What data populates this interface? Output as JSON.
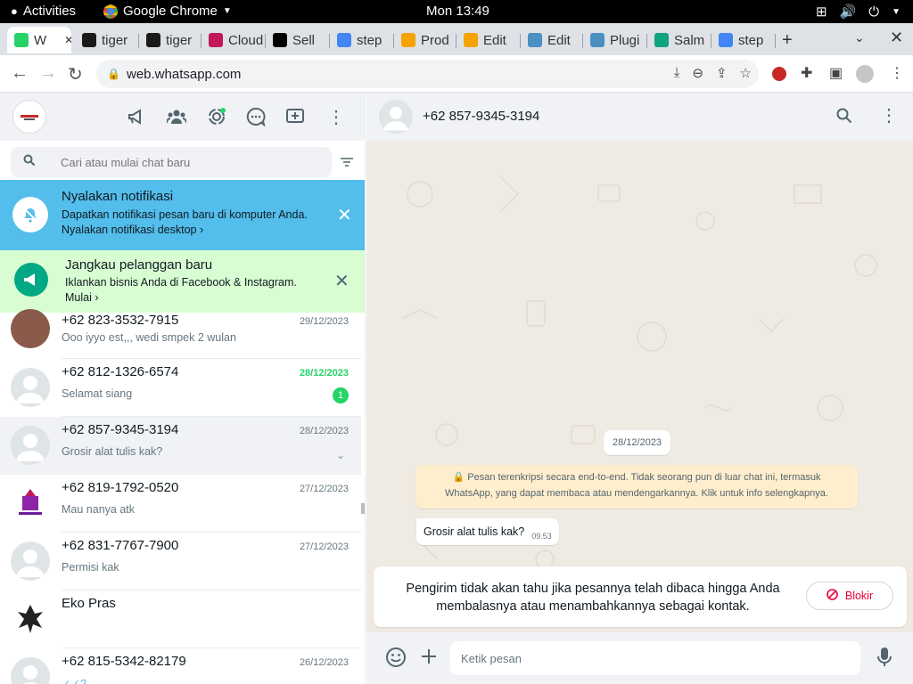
{
  "system": {
    "activities": "Activities",
    "app_name": "Google Chrome",
    "clock": "Mon 13:49"
  },
  "tabs": [
    {
      "label": "W",
      "favicon": "whatsapp-icon",
      "color": "#25d366"
    },
    {
      "label": "tiger",
      "favicon": "vnc-icon",
      "color": "#1a1a1a"
    },
    {
      "label": "tiger",
      "favicon": "vnc-icon",
      "color": "#1a1a1a"
    },
    {
      "label": "Cloud",
      "favicon": "cloudflare-icon",
      "color": "#c2185b"
    },
    {
      "label": "Sell",
      "favicon": "tiktok-icon",
      "color": "#000000"
    },
    {
      "label": "step",
      "favicon": "google-icon",
      "color": "#4285f4"
    },
    {
      "label": "Prod",
      "favicon": "site-icon",
      "color": "#f4a300"
    },
    {
      "label": "Edit",
      "favicon": "site-icon",
      "color": "#f4a300"
    },
    {
      "label": "Edit",
      "favicon": "puzzle-icon",
      "color": "#4a90c2"
    },
    {
      "label": "Plugi",
      "favicon": "puzzle-icon",
      "color": "#4a90c2"
    },
    {
      "label": "Salm",
      "favicon": "openai-icon",
      "color": "#10a37f"
    },
    {
      "label": "step",
      "favicon": "google-icon",
      "color": "#4285f4"
    }
  ],
  "browser": {
    "url": "web.whatsapp.com"
  },
  "sidebar": {
    "search_placeholder": "Cari atau mulai chat baru",
    "notif_banner": {
      "title": "Nyalakan notifikasi",
      "line1": "Dapatkan notifikasi pesan baru di komputer Anda.",
      "line2": "Nyalakan notifikasi desktop ›"
    },
    "ads_banner": {
      "title": "Jangkau pelanggan baru",
      "line1": "Iklankan bisnis Anda di Facebook & Instagram.",
      "line2": "Mulai ›"
    },
    "chats": [
      {
        "name": "+62 823-3532-7915",
        "time": "29/12/2023",
        "message": "Ooo iyyo est,,, wedi smpek 2 wulan"
      },
      {
        "name": "+62 812-1326-6574",
        "time": "28/12/2023",
        "message": "Selamat siang",
        "unread": "1"
      },
      {
        "name": "+62 857-9345-3194",
        "time": "28/12/2023",
        "message": "Grosir alat tulis kak?"
      },
      {
        "name": "+62 819-1792-0520",
        "time": "27/12/2023",
        "message": "Mau nanya atk"
      },
      {
        "name": "+62 831-7767-7900",
        "time": "27/12/2023",
        "message": "Permisi kak"
      },
      {
        "name": "Eko Pras",
        "time": "",
        "message": ""
      },
      {
        "name": "+62 815-5342-82179",
        "time": "26/12/2023",
        "message": "✓✓?"
      }
    ]
  },
  "conversation": {
    "contact": "+62 857-9345-3194",
    "date_chip": "28/12/2023",
    "encryption_line1": "🔒 Pesan terenkripsi secara end-to-end. Tidak seorang pun di luar chat ini, termasuk",
    "encryption_line2": "WhatsApp, yang dapat membaca atau mendengarkannya. Klik untuk info selengkapnya.",
    "message_text": "Grosir alat tulis kak?",
    "message_time": "09.53",
    "notice_text": "Pengirim tidak akan tahu jika pesannya telah dibaca hingga Anda membalasnya atau menambahkannya sebagai kontak.",
    "block_label": "Blokir",
    "composer_placeholder": "Ketik pesan"
  }
}
